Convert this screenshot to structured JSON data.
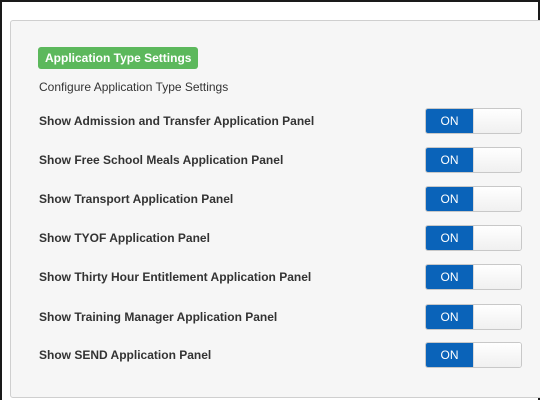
{
  "settings": {
    "title": "Application Type Settings",
    "subtitle": "Configure Application Type Settings",
    "rows": [
      {
        "label": "Show Admission and Transfer Application Panel",
        "toggle": "ON"
      },
      {
        "label": "Show Free School Meals Application Panel",
        "toggle": "ON"
      },
      {
        "label": "Show Transport Application Panel",
        "toggle": "ON"
      },
      {
        "label": "Show TYOF Application Panel",
        "toggle": "ON"
      },
      {
        "label": "Show Thirty Hour Entitlement Application Panel",
        "toggle": "ON"
      },
      {
        "label": "Show Training Manager Application Panel",
        "toggle": "ON"
      },
      {
        "label": "Show SEND Application Panel",
        "toggle": "ON"
      }
    ]
  },
  "colors": {
    "header_badge": "#5cb85c",
    "toggle_on": "#0a63b9"
  }
}
